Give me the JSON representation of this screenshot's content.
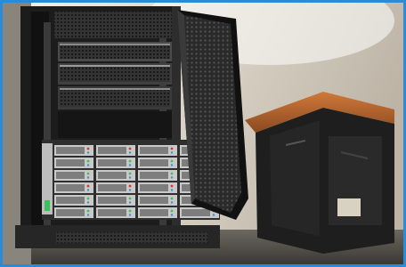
{
  "image": {
    "subject": "server-rack-photo",
    "colors": {
      "border": "#2a8bd6",
      "wall": "#d9d2c4",
      "rack": "#1c1c1c",
      "door_mesh": "#2b2b2b",
      "cabinet_top": "#b8662e",
      "drive_bay": "#c9c9c9"
    }
  }
}
